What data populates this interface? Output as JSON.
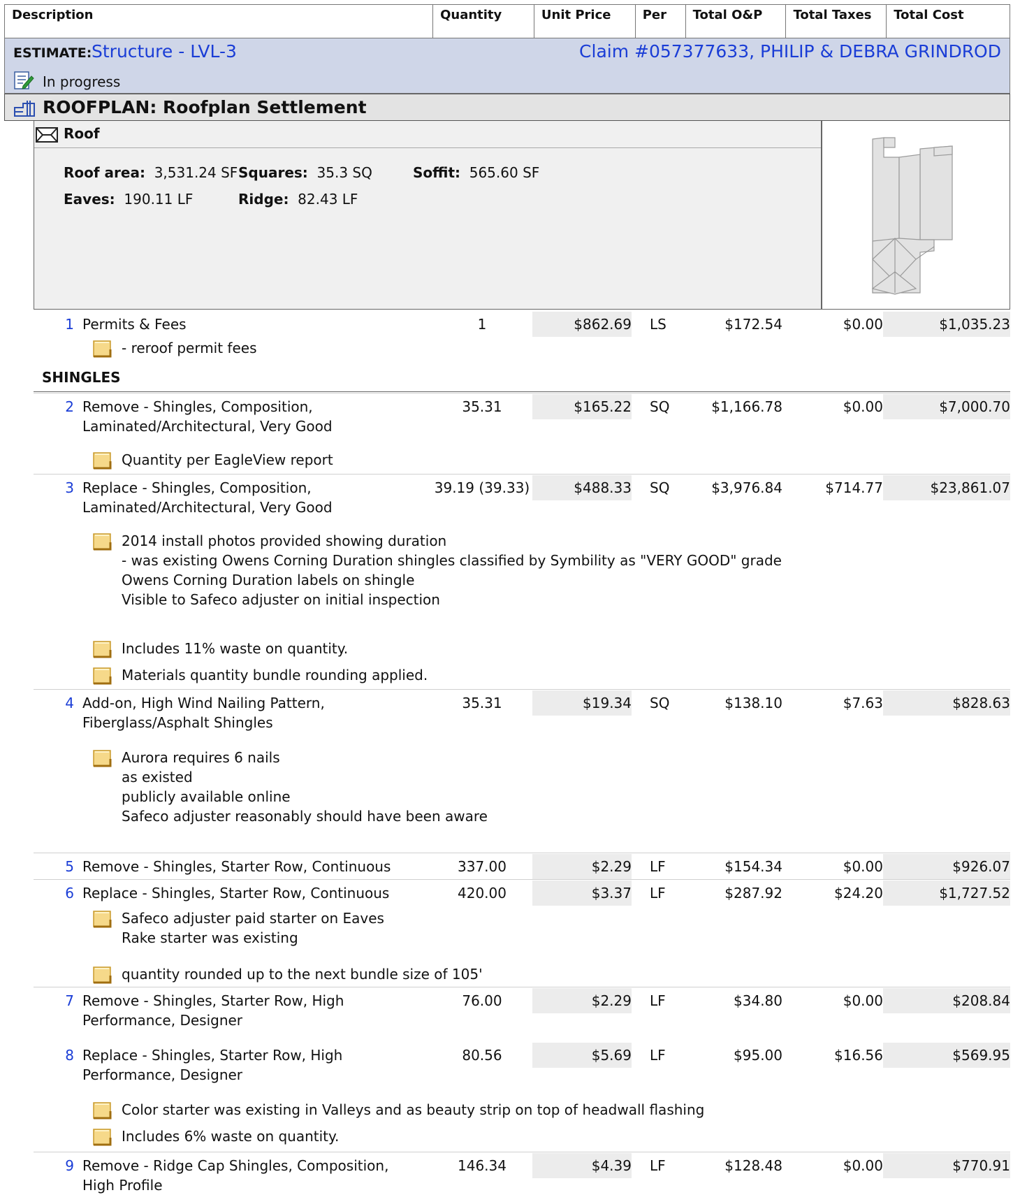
{
  "header": {
    "columns": [
      "Description",
      "Quantity",
      "Unit Price",
      "Per",
      "Total O&P",
      "Total Taxes",
      "Total Cost"
    ]
  },
  "estimate": {
    "label": "ESTIMATE:",
    "name": "Structure - LVL-3",
    "claim": "Claim #057377633, PHILIP & DEBRA GRINDROD",
    "status": "In progress"
  },
  "roofplan": {
    "title": "ROOFPLAN: Roofplan Settlement"
  },
  "roof": {
    "title": "Roof",
    "stats": {
      "roof_area_label": "Roof area:",
      "roof_area": "3,531.24 SF",
      "squares_label": "Squares:",
      "squares": "35.3 SQ",
      "soffit_label": "Soffit:",
      "soffit": "565.60 SF",
      "eaves_label": "Eaves:",
      "eaves": "190.11 LF",
      "ridge_label": "Ridge:",
      "ridge": "82.43 LF"
    }
  },
  "section": {
    "shingles": "SHINGLES"
  },
  "items": [
    {
      "num": "1",
      "desc": "Permits & Fees",
      "qty": "1",
      "unit_price": "$862.69",
      "per": "LS",
      "op": "$172.54",
      "tax": "$0.00",
      "total": "$1,035.23",
      "notes": [
        "- reroof permit fees"
      ]
    },
    {
      "num": "2",
      "desc": "Remove - Shingles, Composition, Laminated/Architectural, Very Good",
      "qty": "35.31",
      "unit_price": "$165.22",
      "per": "SQ",
      "op": "$1,166.78",
      "tax": "$0.00",
      "total": "$7,000.70",
      "notes": [
        "Quantity per EagleView report"
      ]
    },
    {
      "num": "3",
      "desc": "Replace - Shingles, Composition, Laminated/Architectural, Very Good",
      "qty": "39.19 (39.33)",
      "unit_price": "$488.33",
      "per": "SQ",
      "op": "$3,976.84",
      "tax": "$714.77",
      "total": "$23,861.07",
      "notes": [
        "2014 install photos provided showing duration\n- was existing Owens Corning Duration shingles classified by Symbility as \"VERY GOOD\" grade\nOwens Corning Duration labels on shingle\nVisible to Safeco adjuster on initial inspection",
        "Includes 11% waste on quantity.",
        "Materials quantity bundle rounding applied."
      ]
    },
    {
      "num": "4",
      "desc": "Add-on, High Wind Nailing Pattern, Fiberglass/Asphalt Shingles",
      "qty": "35.31",
      "unit_price": "$19.34",
      "per": "SQ",
      "op": "$138.10",
      "tax": "$7.63",
      "total": "$828.63",
      "notes": [
        "Aurora requires 6 nails\nas existed\npublicly available online\nSafeco adjuster reasonably should have been aware"
      ]
    },
    {
      "num": "5",
      "desc": "Remove - Shingles, Starter Row, Continuous",
      "qty": "337.00",
      "unit_price": "$2.29",
      "per": "LF",
      "op": "$154.34",
      "tax": "$0.00",
      "total": "$926.07",
      "notes": []
    },
    {
      "num": "6",
      "desc": "Replace - Shingles, Starter Row, Continuous",
      "qty": "420.00",
      "unit_price": "$3.37",
      "per": "LF",
      "op": "$287.92",
      "tax": "$24.20",
      "total": "$1,727.52",
      "notes": [
        "Safeco adjuster paid starter on Eaves\nRake starter was existing",
        "quantity rounded up to the next bundle size of 105'"
      ]
    },
    {
      "num": "7",
      "desc": "Remove - Shingles, Starter Row, High Performance, Designer",
      "qty": "76.00",
      "unit_price": "$2.29",
      "per": "LF",
      "op": "$34.80",
      "tax": "$0.00",
      "total": "$208.84",
      "notes": []
    },
    {
      "num": "8",
      "desc": "Replace - Shingles, Starter Row, High Performance, Designer",
      "qty": "80.56",
      "unit_price": "$5.69",
      "per": "LF",
      "op": "$95.00",
      "tax": "$16.56",
      "total": "$569.95",
      "notes": [
        "Color starter was existing in Valleys and as beauty strip on top of headwall flashing",
        "Includes 6% waste on quantity."
      ]
    },
    {
      "num": "9",
      "desc": "Remove - Ridge Cap Shingles, Composition, High Profile",
      "qty": "146.34",
      "unit_price": "$4.39",
      "per": "LF",
      "op": "$128.48",
      "tax": "$0.00",
      "total": "$770.91",
      "notes": []
    }
  ],
  "icons": {
    "status": "edit-doc-icon",
    "roofplan": "roofplan-icon",
    "roof": "roof-icon",
    "note": "sticky-note-icon"
  }
}
